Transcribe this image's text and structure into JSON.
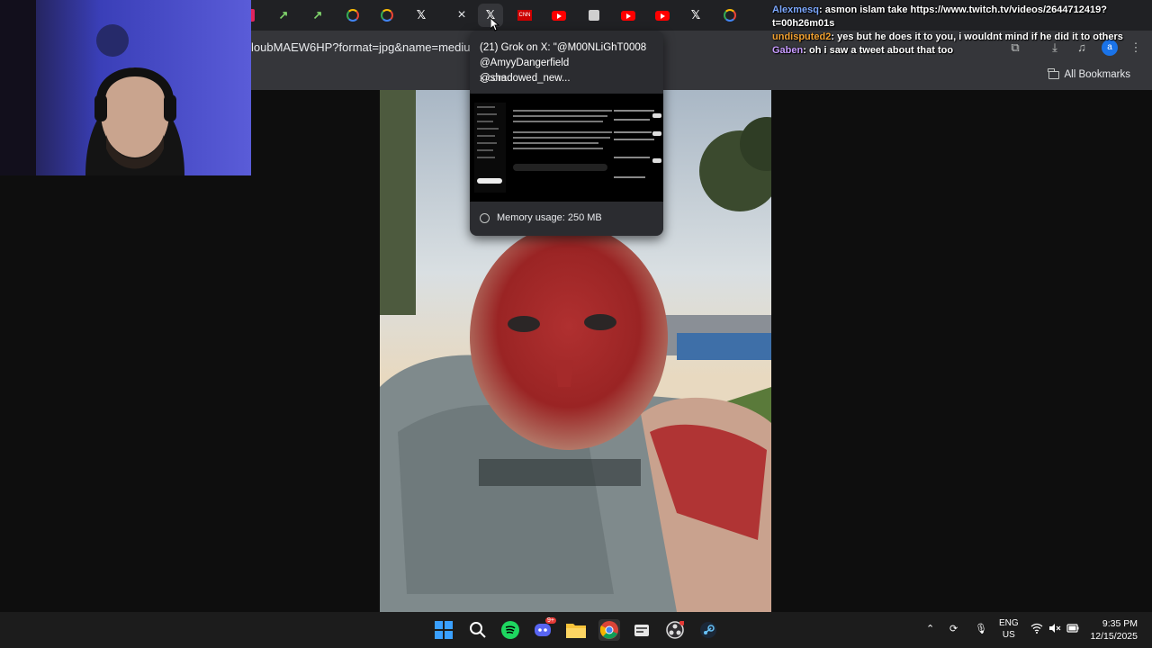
{
  "browser": {
    "url_fragment": "loubMAEW6HP?format=jpg&name=medium",
    "all_bookmarks_label": "All Bookmarks",
    "tabs": [
      {
        "icon": "pink-app-icon"
      },
      {
        "icon": "trend-chart-icon"
      },
      {
        "icon": "trend-chart-icon"
      },
      {
        "icon": "google-icon"
      },
      {
        "icon": "google-icon"
      },
      {
        "icon": "x-logo-icon"
      },
      {
        "icon": "close-icon",
        "active": true
      },
      {
        "icon": "x-logo-icon"
      },
      {
        "icon": "cnn-icon"
      },
      {
        "icon": "youtube-icon"
      },
      {
        "icon": "calendar-icon"
      },
      {
        "icon": "youtube-icon"
      },
      {
        "icon": "youtube-icon"
      },
      {
        "icon": "x-logo-icon"
      },
      {
        "icon": "google-icon"
      }
    ]
  },
  "hovercard": {
    "title": "(21) Grok on X: \"@M00NLiGhT0008 @AmyyDangerfield @shadowed_new...",
    "domain": "x.com",
    "memory": "Memory usage: 250 MB"
  },
  "chat": {
    "messages": [
      {
        "user": "Alexmesq",
        "text": "asmon islam take https://www.twitch.tv/videos/2644712419?t=00h26m01s"
      },
      {
        "user": "undisputed2",
        "text": "yes but he does it to you, i wouldnt mind if he did it to others"
      },
      {
        "user": "Gaben",
        "text": "oh i saw a tweet about that too"
      }
    ]
  },
  "taskbar": {
    "apps": [
      "windows-start-icon",
      "search-icon",
      "spotify-icon",
      "discord-icon",
      "file-explorer-icon",
      "chrome-icon",
      "app-icon",
      "obs-icon",
      "steam-icon"
    ],
    "discord_badge": "9+",
    "lang_line1": "ENG",
    "lang_line2": "US",
    "time": "9:35 PM",
    "date": "12/15/2025"
  }
}
